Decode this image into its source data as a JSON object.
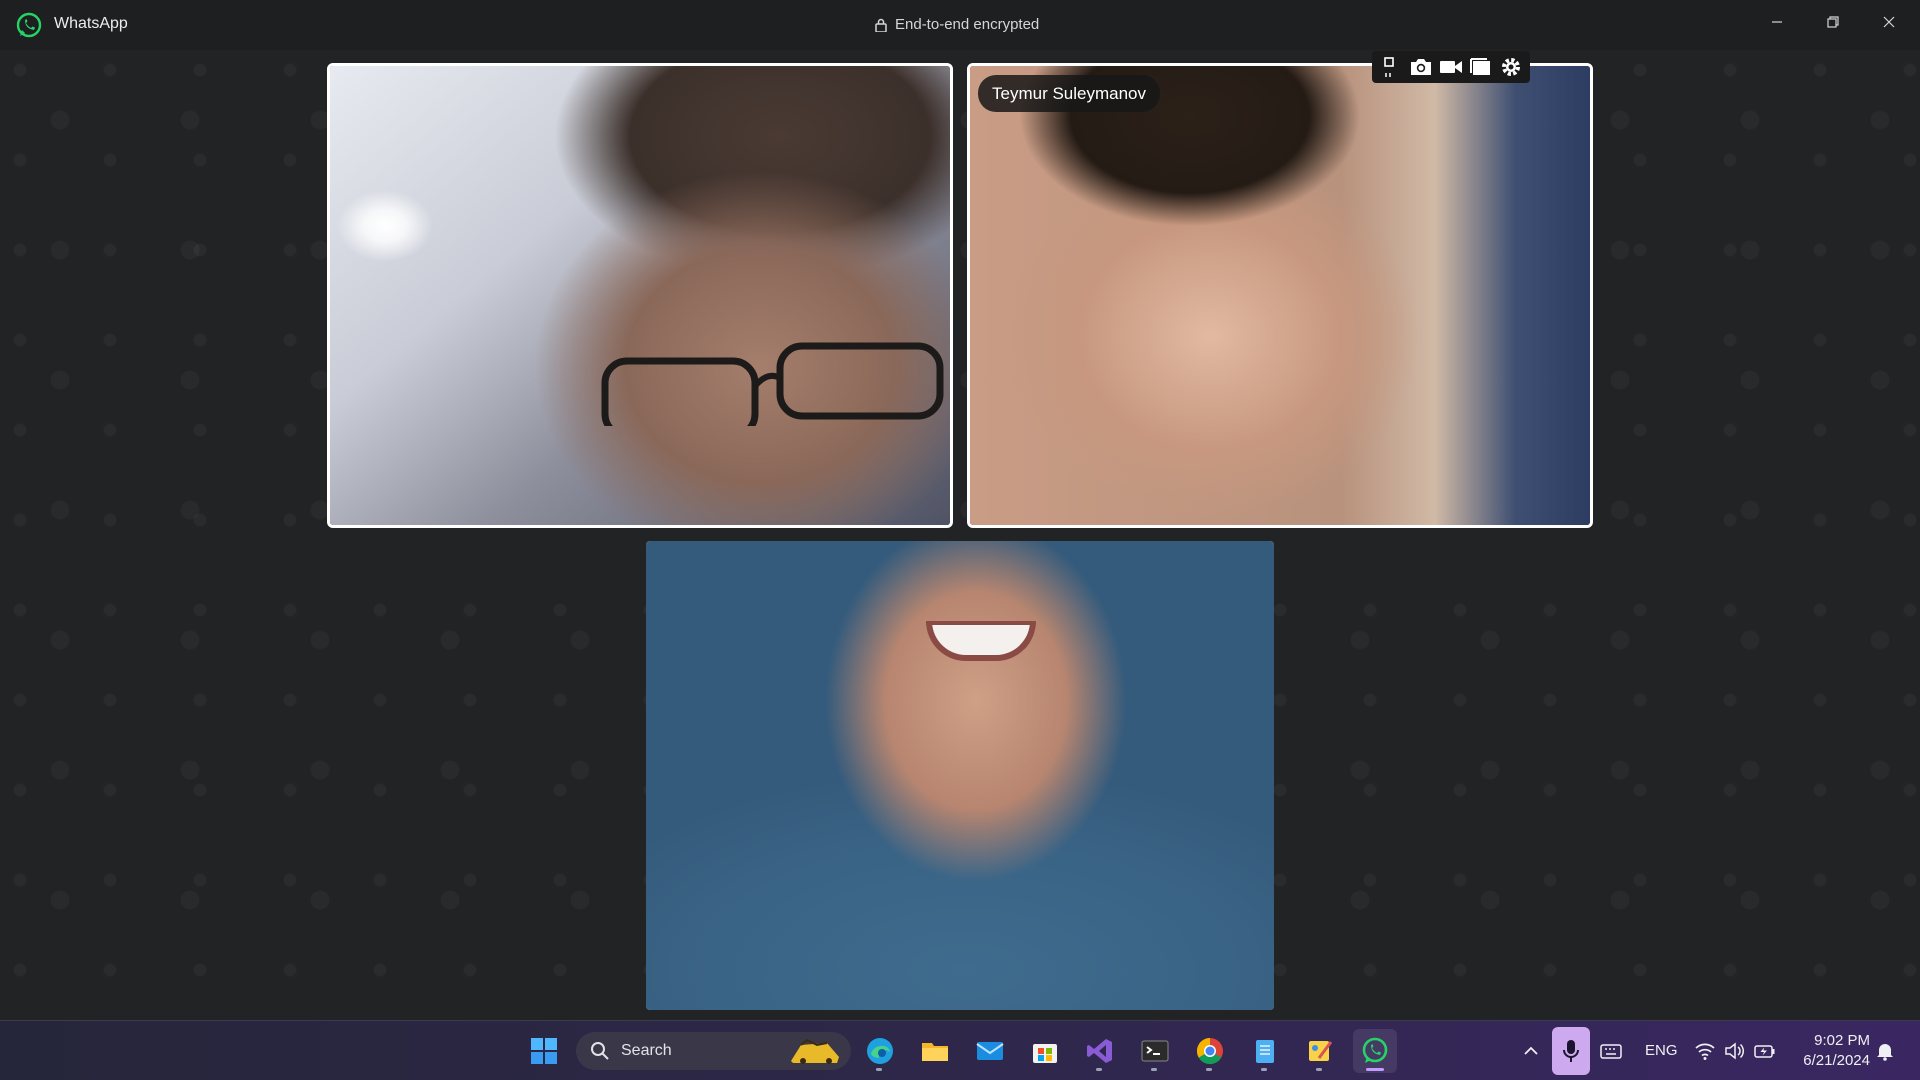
{
  "titlebar": {
    "app_name": "WhatsApp",
    "encryption_label": "End-to-end encrypted"
  },
  "call": {
    "participants": [
      {
        "name": "",
        "position": "top-left",
        "highlighted": true
      },
      {
        "name": "Teymur Suleymanov",
        "position": "top-right",
        "highlighted": true
      },
      {
        "name": "",
        "position": "bottom-center",
        "highlighted": false
      }
    ],
    "camera_toolbar_icons": [
      "pin-icon",
      "camera-icon",
      "video-icon",
      "window-icon",
      "gear-icon"
    ]
  },
  "taskbar": {
    "search_label": "Search",
    "apps": [
      "windows-start-icon",
      "edge-icon",
      "file-explorer-icon",
      "mail-icon",
      "microsoft-store-icon",
      "visual-studio-icon",
      "terminal-icon",
      "chrome-icon",
      "notepad-icon",
      "paint-icon",
      "whatsapp-icon"
    ],
    "active_app": "whatsapp-icon",
    "language": "ENG",
    "time": "9:02 PM",
    "date": "6/21/2024"
  },
  "colors": {
    "accent": "#25d366",
    "stage_bg": "#222324",
    "titlebar_bg": "#1e1f20",
    "mic_active": "#cda9ef"
  }
}
